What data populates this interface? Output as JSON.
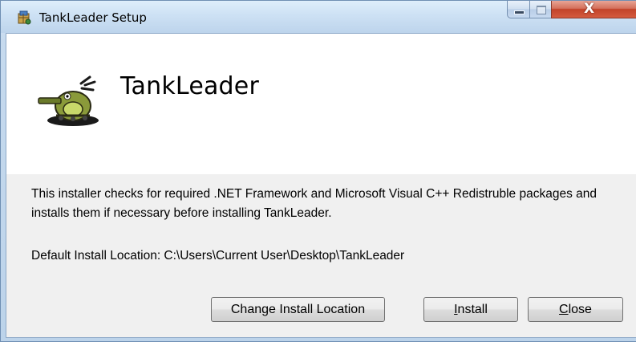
{
  "window": {
    "title": "TankLeader Setup",
    "icon": "installer-icon",
    "controls": {
      "minimize": "minimize-icon",
      "maximize": "maximize-icon",
      "close": "close-icon"
    }
  },
  "banner": {
    "product_name": "TankLeader",
    "logo": "tank-logo"
  },
  "content": {
    "description": "This installer checks for required .NET Framework and Microsoft Visual C++ Redistruble packages and installs them if necessary before installing TankLeader.",
    "location_text": "Default Install Location: C:\\Users\\Current User\\Desktop\\TankLeader"
  },
  "buttons": {
    "change_location": "Change Install Location",
    "install_mnemonic": "I",
    "install_rest": "nstall",
    "close_mnemonic": "C",
    "close_rest": "lose"
  },
  "colors": {
    "title_gradient_top": "#dfeefb",
    "close_button": "#c2432a",
    "client_background": "#f0f0f0",
    "banner_background": "#ffffff"
  }
}
